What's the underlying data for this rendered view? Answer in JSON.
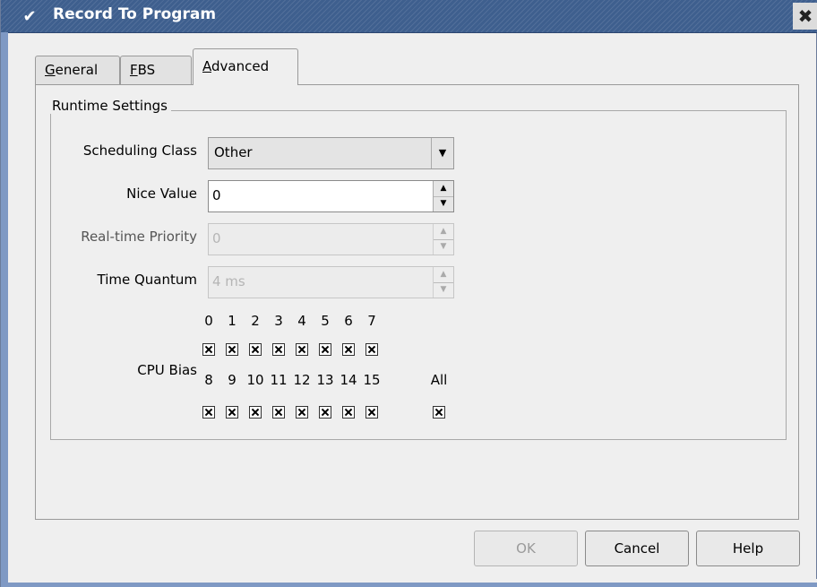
{
  "window": {
    "title": "Record To Program",
    "menu_icon": "chevron-down-icon",
    "close_icon": "close-icon",
    "menu_glyph": "✔",
    "close_glyph": "✖"
  },
  "tabs": [
    {
      "key": "G",
      "rest": "eneral"
    },
    {
      "key": "F",
      "rest": "BS"
    },
    {
      "key": "A",
      "rest": "dvanced"
    }
  ],
  "active_tab": "Advanced",
  "runtime": {
    "legend": "Runtime Settings",
    "scheduling_class": {
      "label": "Scheduling Class",
      "value": "Other",
      "arrow": "▼"
    },
    "nice_value": {
      "label": "Nice Value",
      "value": "0"
    },
    "realtime_priority": {
      "label": "Real-time Priority",
      "value": "0",
      "disabled": true
    },
    "time_quantum": {
      "label": "Time Quantum",
      "value": "4 ms",
      "disabled": true
    },
    "spin_up": "▲",
    "spin_down": "▼",
    "cpu_bias": {
      "label": "CPU Bias",
      "row1": [
        "0",
        "1",
        "2",
        "3",
        "4",
        "5",
        "6",
        "7"
      ],
      "row2": [
        "8",
        "9",
        "10",
        "11",
        "12",
        "13",
        "14",
        "15"
      ],
      "all_label": "All",
      "checked": true
    }
  },
  "buttons": {
    "ok": "OK",
    "cancel": "Cancel",
    "help": "Help"
  },
  "colors": {
    "titlebar": "#3e5f8e",
    "window_bg": "#efefef",
    "frame_strip": "#7f99c4"
  }
}
